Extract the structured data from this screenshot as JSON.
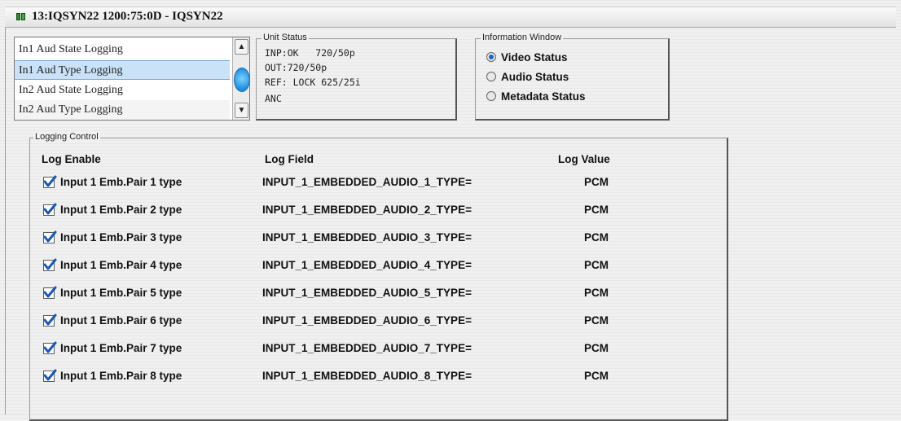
{
  "window": {
    "title": "13:IQSYN22  1200:75:0D  - IQSYN22",
    "icon": "device-icon"
  },
  "log_list": {
    "items": [
      "In1 Aud State Logging",
      "In1 Aud Type Logging",
      "In2 Aud State Logging",
      "In2 Aud Type Logging"
    ],
    "selected_index": 1
  },
  "unit_status": {
    "title": "Unit Status",
    "lines": [
      "INP:OK   720/50p",
      "OUT:720/50p",
      "REF: LOCK 625/25i",
      "ANC"
    ]
  },
  "info_window": {
    "title": "Information Window",
    "options": [
      "Video Status",
      "Audio Status",
      "Metadata Status"
    ],
    "selected": "Video Status"
  },
  "logging_control": {
    "title": "Logging Control",
    "headers": {
      "enable": "Log Enable",
      "field": "Log Field",
      "value": "Log Value"
    },
    "rows": [
      {
        "label": "Input 1 Emb.Pair 1 type",
        "field": "INPUT_1_EMBEDDED_AUDIO_1_TYPE=",
        "value": "PCM",
        "checked": true
      },
      {
        "label": "Input 1 Emb.Pair 2 type",
        "field": "INPUT_1_EMBEDDED_AUDIO_2_TYPE=",
        "value": "PCM",
        "checked": true
      },
      {
        "label": "Input 1 Emb.Pair 3 type",
        "field": "INPUT_1_EMBEDDED_AUDIO_3_TYPE=",
        "value": "PCM",
        "checked": true
      },
      {
        "label": "Input 1 Emb.Pair 4 type",
        "field": "INPUT_1_EMBEDDED_AUDIO_4_TYPE=",
        "value": "PCM",
        "checked": true
      },
      {
        "label": "Input 1 Emb.Pair 5 type",
        "field": "INPUT_1_EMBEDDED_AUDIO_5_TYPE=",
        "value": "PCM",
        "checked": true
      },
      {
        "label": "Input 1 Emb.Pair 6 type",
        "field": "INPUT_1_EMBEDDED_AUDIO_6_TYPE=",
        "value": "PCM",
        "checked": true
      },
      {
        "label": "Input 1 Emb.Pair 7 type",
        "field": "INPUT_1_EMBEDDED_AUDIO_7_TYPE=",
        "value": "PCM",
        "checked": true
      },
      {
        "label": "Input 1 Emb.Pair 8 type",
        "field": "INPUT_1_EMBEDDED_AUDIO_8_TYPE=",
        "value": "PCM",
        "checked": true
      }
    ]
  },
  "colors": {
    "checkbox_mark": "#1a58b5",
    "selection": "#c9e2f8",
    "radio_selected": "#1668c8"
  }
}
